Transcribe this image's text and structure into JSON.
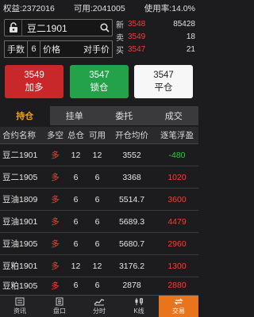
{
  "status": {
    "equity": "权益:2372016",
    "available": "可用:2041005",
    "usage": "使用率:14.0%"
  },
  "order": {
    "symbol": "豆二1901",
    "qty_label": "手数",
    "qty_value": "6",
    "price_label": "价格",
    "price_value": "对手价"
  },
  "quotes": [
    {
      "label": "新",
      "price": "3548",
      "volume": "85428"
    },
    {
      "label": "卖",
      "price": "3549",
      "volume": "18"
    },
    {
      "label": "买",
      "price": "3547",
      "volume": "21"
    }
  ],
  "buttons": {
    "buy_price": "3549",
    "buy_label": "加多",
    "lock_price": "3547",
    "lock_label": "锁仓",
    "close_price": "3547",
    "close_label": "平仓"
  },
  "tabs": [
    "持仓",
    "挂单",
    "委托",
    "成交"
  ],
  "columns": [
    "合约名称",
    "多空",
    "总仓",
    "可用",
    "开仓均价",
    "逐笔浮盈"
  ],
  "rows": [
    {
      "name": "豆二1901",
      "side": "多",
      "total": "12",
      "avail": "12",
      "avg": "3552",
      "pnl": "-480",
      "pnl_color": "green"
    },
    {
      "name": "豆二1905",
      "side": "多",
      "total": "6",
      "avail": "6",
      "avg": "3368",
      "pnl": "1020",
      "pnl_color": "red"
    },
    {
      "name": "豆油1809",
      "side": "多",
      "total": "6",
      "avail": "6",
      "avg": "5514.7",
      "pnl": "3600",
      "pnl_color": "red"
    },
    {
      "name": "豆油1901",
      "side": "多",
      "total": "6",
      "avail": "6",
      "avg": "5689.3",
      "pnl": "4479",
      "pnl_color": "red"
    },
    {
      "name": "豆油1905",
      "side": "多",
      "total": "6",
      "avail": "6",
      "avg": "5680.7",
      "pnl": "2960",
      "pnl_color": "red"
    },
    {
      "name": "豆粕1901",
      "side": "多",
      "total": "12",
      "avail": "12",
      "avg": "3176.2",
      "pnl": "1300",
      "pnl_color": "red"
    },
    {
      "name": "豆粕1905",
      "side": "多",
      "total": "6",
      "avail": "6",
      "avg": "2878",
      "pnl": "2880",
      "pnl_color": "red"
    }
  ],
  "nav": [
    {
      "label": "资讯",
      "icon": "news-icon"
    },
    {
      "label": "盘口",
      "icon": "orderbook-icon"
    },
    {
      "label": "分时",
      "icon": "timeshare-icon"
    },
    {
      "label": "K线",
      "icon": "candlestick-icon"
    },
    {
      "label": "交易",
      "icon": "trade-icon"
    }
  ],
  "colors": {
    "buy": "#c8282a",
    "lock": "#23a24a",
    "close": "#f7f7f7",
    "active_tab": "#f0a21a",
    "nav_highlight": "#e8741c",
    "profit": "#ff3b30",
    "loss": "#2ecc40"
  }
}
